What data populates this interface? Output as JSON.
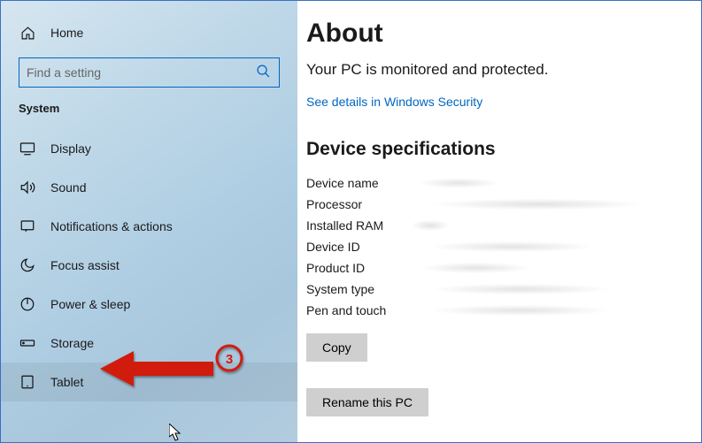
{
  "sidebar": {
    "home": "Home",
    "search_placeholder": "Find a setting",
    "section": "System",
    "items": [
      {
        "label": "Display"
      },
      {
        "label": "Sound"
      },
      {
        "label": "Notifications & actions"
      },
      {
        "label": "Focus assist"
      },
      {
        "label": "Power & sleep"
      },
      {
        "label": "Storage"
      },
      {
        "label": "Tablet"
      }
    ]
  },
  "annotation": {
    "badge": "3"
  },
  "main": {
    "title": "About",
    "status": "Your PC is monitored and protected.",
    "security_link": "See details in Windows Security",
    "specs_heading": "Device specifications",
    "specs": [
      {
        "label": "Device name"
      },
      {
        "label": "Processor"
      },
      {
        "label": "Installed RAM"
      },
      {
        "label": "Device ID"
      },
      {
        "label": "Product ID"
      },
      {
        "label": "System type"
      },
      {
        "label": "Pen and touch"
      }
    ],
    "copy_button": "Copy",
    "rename_button": "Rename this PC"
  }
}
